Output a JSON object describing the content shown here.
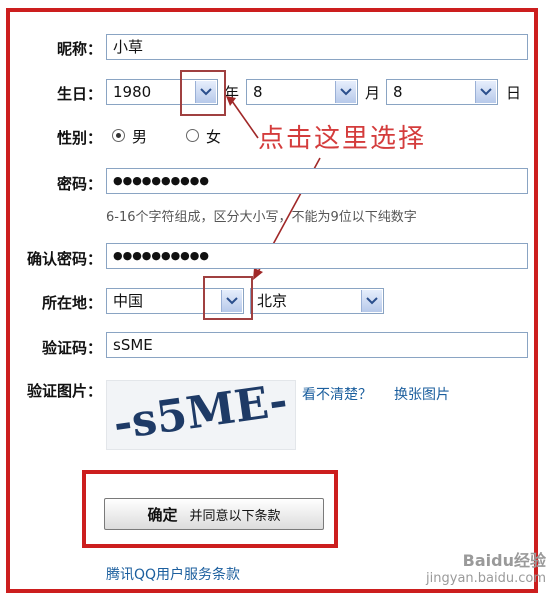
{
  "form": {
    "nickname": {
      "label": "昵称：",
      "value": "小草"
    },
    "birthday": {
      "label": "生日：",
      "year": "1980",
      "year_unit": "年",
      "month": "8",
      "month_unit": "月",
      "day": "8",
      "day_unit": "日"
    },
    "gender": {
      "label": "性别：",
      "male": "男",
      "female": "女",
      "selected": "male"
    },
    "password": {
      "label": "密码：",
      "value": "●●●●●●●●●●",
      "hint": "6-16个字符组成，区分大小写，不能为9位以下纯数字"
    },
    "confirm_password": {
      "label": "确认密码：",
      "value": "●●●●●●●●●●"
    },
    "location": {
      "label": "所在地：",
      "country": "中国",
      "city": "北京"
    },
    "captcha": {
      "label": "验证码：",
      "value": "sSME"
    },
    "captcha_image": {
      "label": "验证图片：",
      "text": "-s5ME-",
      "cant_see": "看不清楚？",
      "change": "换张图片"
    },
    "submit": {
      "main": "确定",
      "sub": "并同意以下条款"
    },
    "terms_link": "腾讯QQ用户服务条款"
  },
  "annotation": {
    "text": "点击这里选择"
  },
  "watermark": {
    "line1": "Baidu经验",
    "line2": "jingyan.baidu.com"
  },
  "colors": {
    "highlight_border": "#cc1e1e",
    "link": "#1c5f9e",
    "annotation": "#d43c3c"
  }
}
